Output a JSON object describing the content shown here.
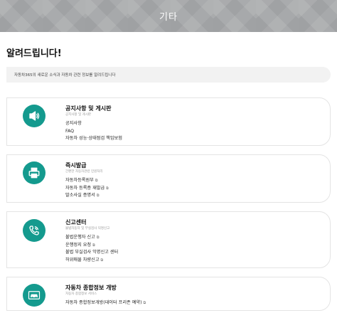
{
  "banner": {
    "title": "기타"
  },
  "page": {
    "title": "알려드립니다!"
  },
  "notice": {
    "text": "자동차365의 새로운 소식과 자동차 관련 정보를 알려드립니다"
  },
  "cards": [
    {
      "title": "공지사항 및 게시판",
      "subtitle": "공지사항 및 게시판",
      "icon": "megaphone-icon",
      "links": [
        {
          "label": "공지사항",
          "external": false
        },
        {
          "label": "FAQ",
          "external": false
        },
        {
          "label": "자동차 성능·상태점검 책임보험",
          "external": false
        }
      ]
    },
    {
      "title": "즉시발급",
      "subtitle": "간편한 자동차관련 민원처리",
      "icon": "printer-icon",
      "links": [
        {
          "label": "자동차등록원부",
          "external": true
        },
        {
          "label": "자동차 등록증 재발급",
          "external": true
        },
        {
          "label": "말소사실 증명서",
          "external": true
        }
      ]
    },
    {
      "title": "신고센터",
      "subtitle": "불법자동차 및 부실검사 익명신고",
      "icon": "phone-icon",
      "links": [
        {
          "label": "불법운행자 신고",
          "external": true
        },
        {
          "label": "운행정지 요청",
          "external": true
        },
        {
          "label": "불법 부실검사 익명신고 센터",
          "external": false
        },
        {
          "label": "허위매물 차량신고",
          "external": true
        }
      ]
    },
    {
      "title": "자동차 종합정보 개방",
      "subtitle": "자동차 종합정보 서비스",
      "icon": "car-icon",
      "links": [
        {
          "label": "자동차 종합정보개방(데이터 프리존 예약)",
          "external": true
        }
      ]
    }
  ],
  "external_glyph": "⧉",
  "colors": {
    "accent": "#149a8e",
    "banner": "#a9abad",
    "notice_bg": "#f2f2f2"
  }
}
